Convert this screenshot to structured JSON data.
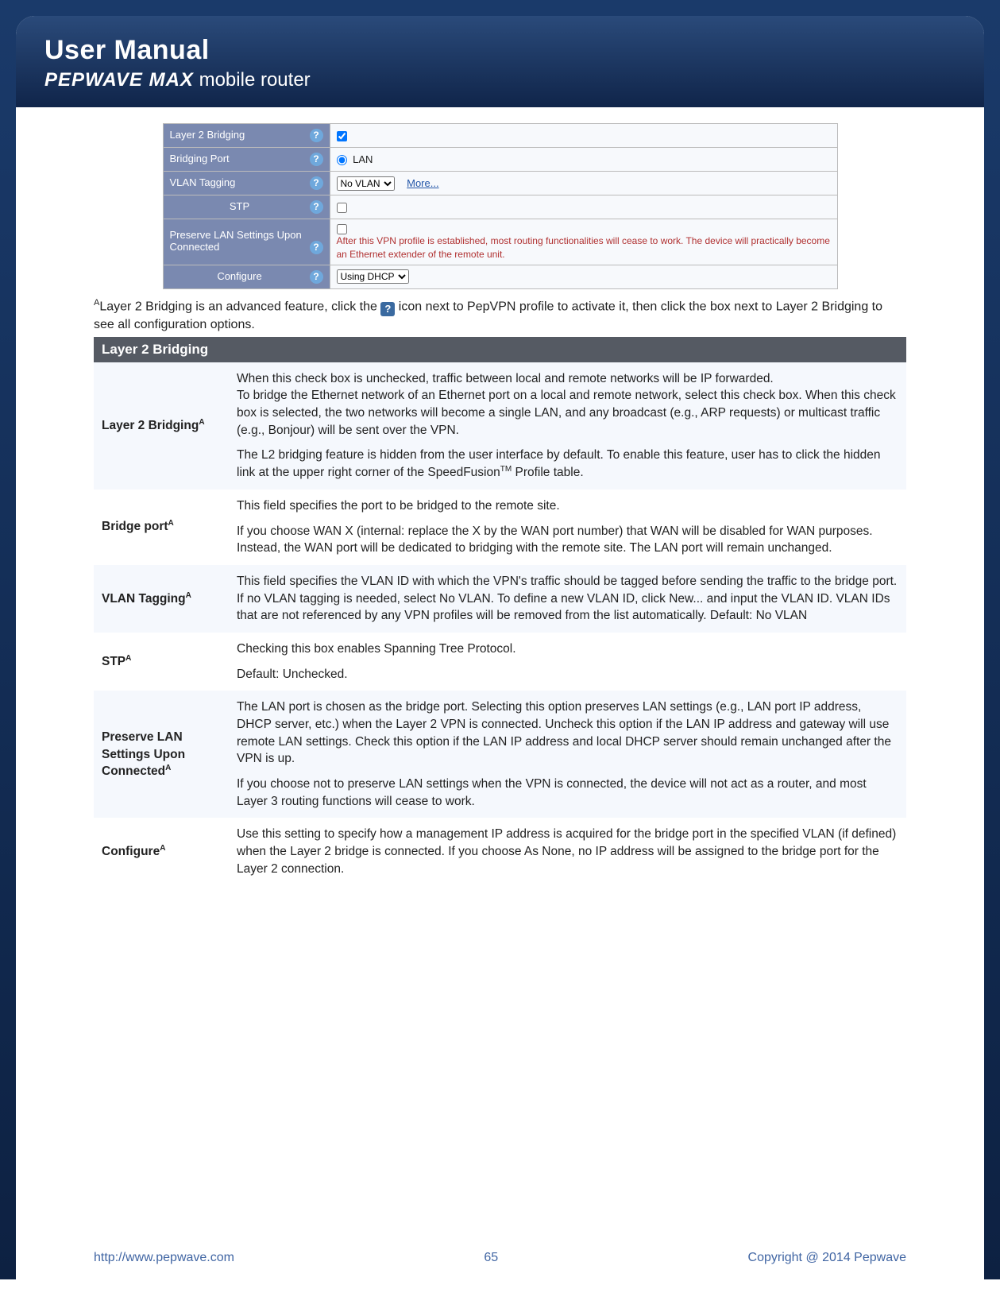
{
  "header": {
    "title": "User Manual",
    "subtitle_brand": "PEPWAVE MAX",
    "subtitle_rest": " mobile router"
  },
  "cfg": {
    "rows": {
      "l2b": {
        "label": "Layer 2 Bridging",
        "checked": true
      },
      "bport": {
        "label": "Bridging Port",
        "radio_label": "LAN"
      },
      "vlan": {
        "label": "VLAN Tagging",
        "select": "No VLAN",
        "more": "More..."
      },
      "stp": {
        "label": "STP",
        "checked": false
      },
      "preserve": {
        "label": "Preserve LAN Settings Upon Connected",
        "checked": false,
        "warn": "After this VPN profile is established, most routing functionalities will cease to work. The device will practically become an Ethernet extender of the remote unit."
      },
      "configure": {
        "label": "Configure",
        "select": "Using DHCP"
      }
    }
  },
  "note": {
    "pre_sup": "A",
    "text_before_icon": "Layer 2 Bridging is an advanced feature, click the ",
    "text_after_icon": " icon next to PepVPN profile to activate it, then click the box next to Layer 2 Bridging to see all configuration options."
  },
  "desc": {
    "title": "Layer 2 Bridging",
    "rows": [
      {
        "label": "Layer 2 Bridging",
        "paras": [
          "When this check box is unchecked, traffic between local and remote networks will be IP forwarded.",
          "To bridge the Ethernet network of an Ethernet port on a local and remote network, select this check box. When this check box is selected, the two networks will become a single LAN, and any broadcast (e.g., ARP requests) or multicast traffic (e.g., Bonjour) will be sent over the VPN.",
          "The L2 bridging feature is hidden from the user interface by default. To enable this feature, user has to click the hidden link at the upper right corner of the SpeedFusion™ Profile table."
        ]
      },
      {
        "label": "Bridge port",
        "paras": [
          "This field specifies the port to be bridged to the remote site.",
          "If you choose WAN X (internal: replace the X by the WAN port number) that WAN will be disabled for WAN purposes. Instead, the WAN port will be dedicated to bridging with the remote site. The LAN port will remain unchanged."
        ]
      },
      {
        "label": "VLAN Tagging",
        "paras": [
          "This field specifies the VLAN ID with which the VPN's traffic should be tagged before sending the traffic to the bridge port. If no VLAN tagging is needed, select No VLAN. To define a new VLAN ID, click New... and input the VLAN ID. VLAN IDs that are not referenced by any VPN profiles will be removed from the list automatically. Default: No VLAN"
        ]
      },
      {
        "label": "STP",
        "paras": [
          "Checking this box enables Spanning Tree Protocol.",
          "Default: Unchecked."
        ]
      },
      {
        "label": "Preserve LAN Settings Upon Connected",
        "paras": [
          "The LAN port is chosen as the bridge port. Selecting this option preserves LAN settings (e.g., LAN port IP address, DHCP server, etc.) when the Layer 2 VPN is connected. Uncheck this option if the LAN IP address and gateway will use remote LAN settings. Check this option if the LAN IP address and local DHCP server should remain unchanged after the VPN is up.",
          "If you choose not to preserve LAN settings when the VPN is connected, the device will not act as a router, and most Layer 3 routing functions will cease to work."
        ]
      },
      {
        "label": "Configure",
        "paras": [
          "Use this setting to specify how a management IP address is acquired for the bridge port in the specified VLAN (if defined) when the Layer 2 bridge is connected. If you choose As None, no IP address will be assigned to the bridge port for the Layer 2 connection."
        ]
      }
    ]
  },
  "footer": {
    "url": "http://www.pepwave.com",
    "page": "65",
    "copyright": "Copyright @ 2014 Pepwave"
  }
}
